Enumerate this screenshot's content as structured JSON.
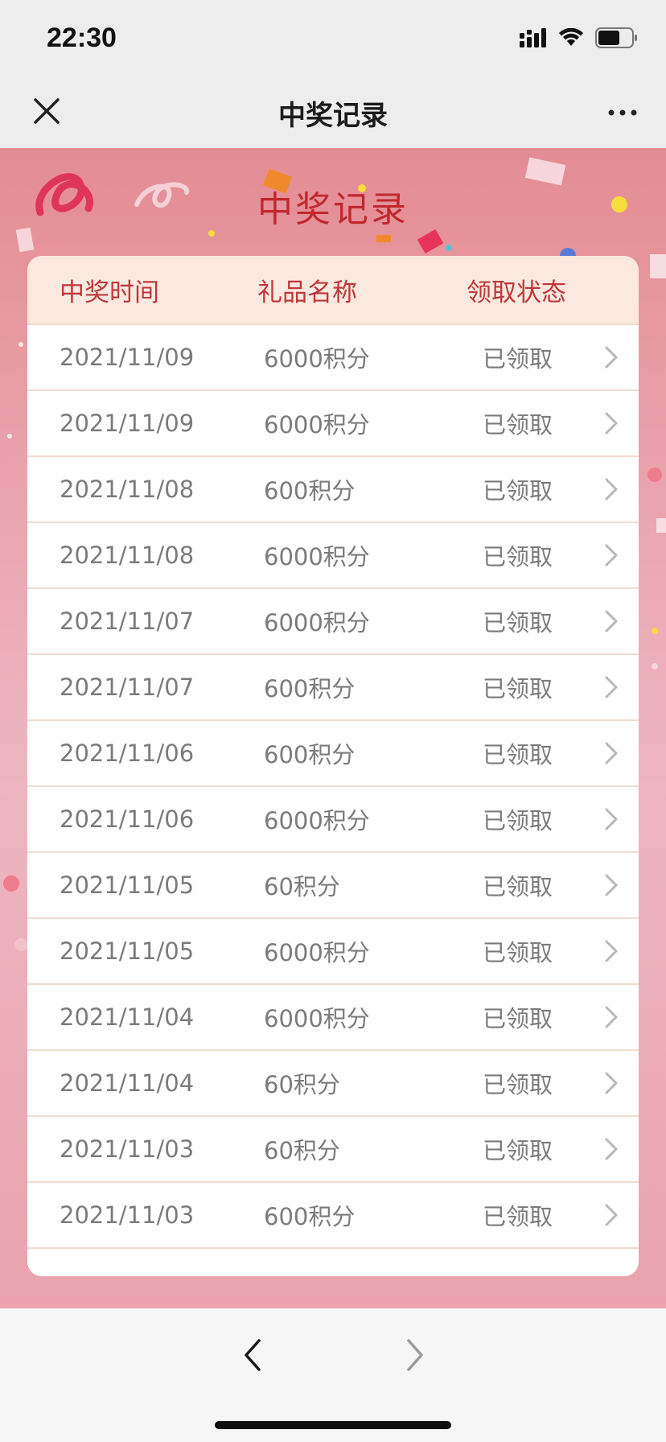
{
  "status_bar": {
    "time": "22:30"
  },
  "nav": {
    "title": "中奖记录",
    "close_icon": "close-icon",
    "more_icon": "more-icon"
  },
  "page": {
    "heading": "中奖记录"
  },
  "table": {
    "headers": [
      "中奖时间",
      "礼品名称",
      "领取状态"
    ],
    "rows": [
      {
        "date": "2021/11/09",
        "gift": "6000积分",
        "status": "已领取"
      },
      {
        "date": "2021/11/09",
        "gift": "6000积分",
        "status": "已领取"
      },
      {
        "date": "2021/11/08",
        "gift": "600积分",
        "status": "已领取"
      },
      {
        "date": "2021/11/08",
        "gift": "6000积分",
        "status": "已领取"
      },
      {
        "date": "2021/11/07",
        "gift": "6000积分",
        "status": "已领取"
      },
      {
        "date": "2021/11/07",
        "gift": "600积分",
        "status": "已领取"
      },
      {
        "date": "2021/11/06",
        "gift": "600积分",
        "status": "已领取"
      },
      {
        "date": "2021/11/06",
        "gift": "6000积分",
        "status": "已领取"
      },
      {
        "date": "2021/11/05",
        "gift": "60积分",
        "status": "已领取"
      },
      {
        "date": "2021/11/05",
        "gift": "6000积分",
        "status": "已领取"
      },
      {
        "date": "2021/11/04",
        "gift": "6000积分",
        "status": "已领取"
      },
      {
        "date": "2021/11/04",
        "gift": "60积分",
        "status": "已领取"
      },
      {
        "date": "2021/11/03",
        "gift": "60积分",
        "status": "已领取"
      },
      {
        "date": "2021/11/03",
        "gift": "600积分",
        "status": "已领取"
      }
    ]
  },
  "bottom_bar": {
    "back_icon": "chevron-left-icon",
    "forward_icon": "chevron-right-icon"
  },
  "colors": {
    "heading": "#c0282c",
    "header_bg": "#fbe9df",
    "header_text": "#c0363a",
    "row_text": "#7b7b7b",
    "background": "#e48c93"
  }
}
